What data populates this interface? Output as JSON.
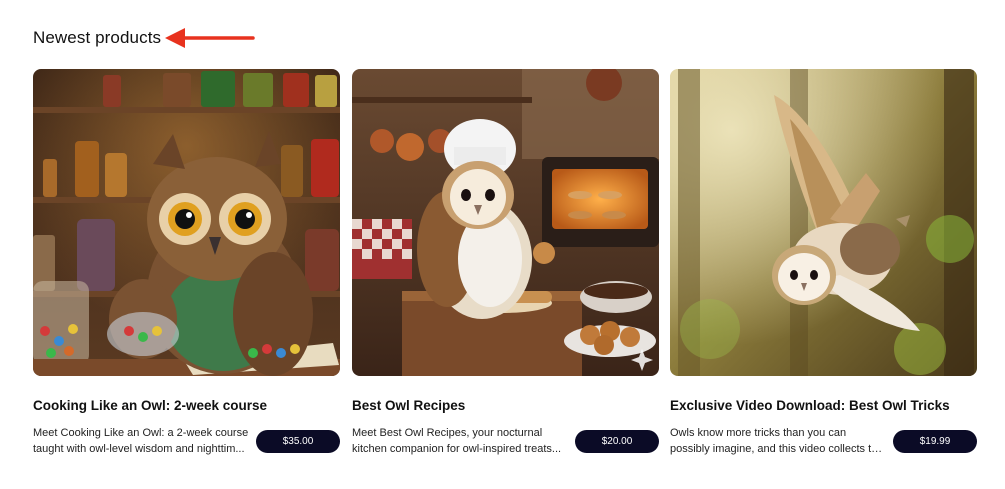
{
  "section": {
    "title": "Newest products"
  },
  "colors": {
    "arrow": "#e8321e",
    "button_bg": "#0b0b26",
    "button_text": "#ffffff"
  },
  "products": [
    {
      "title": "Cooking Like an Owl: 2-week course",
      "description": "Meet Cooking Like an Owl: a 2-week course taught with owl-level wisdom and nighttim...",
      "price": "$35.00",
      "image": "owl-cooking-pantry-image"
    },
    {
      "title": "Best Owl Recipes",
      "description": "Meet Best Owl Recipes, your nocturnal kitchen companion for owl-inspired treats...",
      "price": "$20.00",
      "image": "owl-chef-baking-image"
    },
    {
      "title": "Exclusive Video Download: Best Owl Tricks",
      "description": "Owls know more tricks than you can possibly imagine, and this video collects the very be...",
      "price": "$19.99",
      "image": "owl-flying-forest-image"
    }
  ]
}
